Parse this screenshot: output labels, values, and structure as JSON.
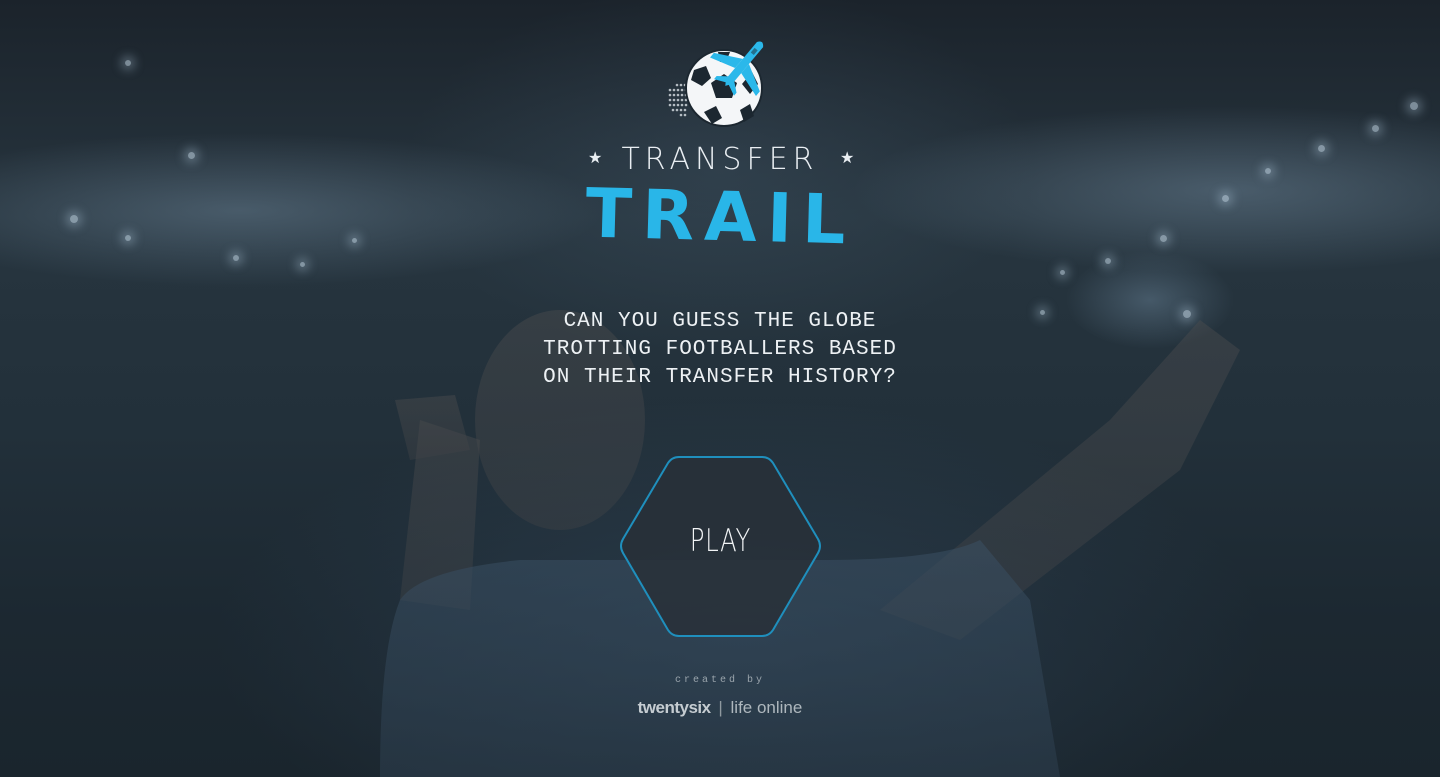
{
  "app": {
    "title_top": "TRANSFER",
    "title_main": "TRAIL",
    "star_left": "★",
    "star_right": "★"
  },
  "intro": {
    "tagline_lines": [
      "CAN YOU GUESS THE GLOBE",
      "TROTTING FOOTBALLERS BASED",
      "ON THEIR TRANSFER HISTORY?"
    ]
  },
  "actions": {
    "play_label": "PLAY"
  },
  "footer": {
    "created_by": "created by",
    "brand_name": "twentysix",
    "brand_separator": "|",
    "brand_tagline": "life online"
  },
  "colors": {
    "accent": "#29b6e8",
    "text": "#edf1f4",
    "hex_border": "#1f8fbd"
  },
  "icons": {
    "logo": "football-airplane-icon"
  }
}
